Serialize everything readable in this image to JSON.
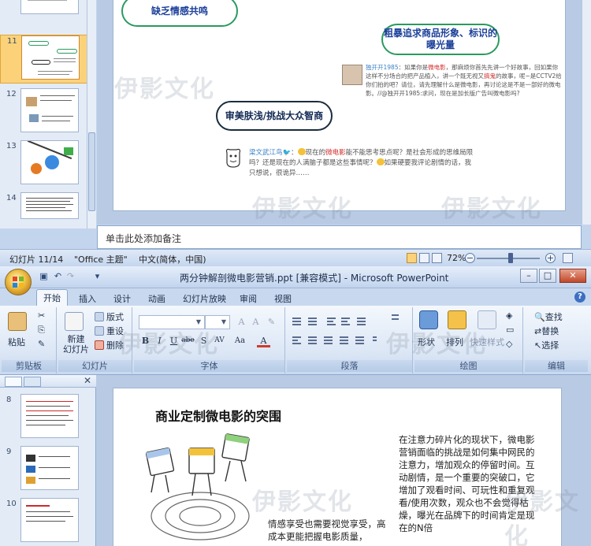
{
  "watermark": "伊影文化",
  "window1": {
    "thumbnails": [
      {
        "number": "11",
        "selected": true
      },
      {
        "number": "12",
        "selected": false
      },
      {
        "number": "13",
        "selected": false
      },
      {
        "number": "14",
        "selected": false
      }
    ],
    "slide": {
      "pill_top": "缺乏情感共鸣",
      "pill_right": "粗暴追求商品形象、标识的曝光量",
      "pill_mid": "审美肤浅/挑战大众智商",
      "weibo1": {
        "name": "独开开1985",
        "segments": [
          "：如果你是",
          "微电影",
          "，那麻烦你首先先讲一个好故事，回如果你这样不分场合的把产品植入，讲一个既无视又",
          "搞鬼",
          "的故事，呢~是CCTV2给你们拍的吧？请位，请先理解什么是微电影，再讨论这是不是一部好的微电影。//@独开开1985:求问，现在是加长版广告叫微电影吗?"
        ]
      },
      "weibo2": {
        "name": "梁文武江鸟🐦",
        "segments": [
          "：",
          "现在的",
          "微电影",
          "能不能思考思点呢？是社会形成的思维局限吗？还是现在的人满脑子都是这些事情呢？",
          "如果硬要我评论剧情的话，我只想说，很诡异……"
        ]
      }
    },
    "notes_placeholder": "单击此处添加备注",
    "status": {
      "slide_info": "幻灯片 11/14",
      "theme": "\"Office 主题\"",
      "language": "中文(简体，中国)",
      "zoom": "72%"
    }
  },
  "window2": {
    "title": "两分钟解剖微电影营销.ppt [兼容模式] - Microsoft PowerPoint",
    "tabs": [
      "开始",
      "插入",
      "设计",
      "动画",
      "幻灯片放映",
      "审阅",
      "视图"
    ],
    "active_tab": "开始",
    "ribbon": {
      "clipboard": {
        "paste": "粘贴",
        "label": "剪贴板"
      },
      "slides": {
        "new_slide": "新建\n幻灯片",
        "layout": "版式",
        "reset": "重设",
        "delete": "删除",
        "label": "幻灯片"
      },
      "font": {
        "label": "字体",
        "buttons": [
          "B",
          "I",
          "U",
          "abe",
          "S",
          "AV",
          "Aa",
          "A"
        ]
      },
      "paragraph": {
        "label": "段落"
      },
      "drawing": {
        "shape": "形状",
        "arrange": "排列",
        "quick_styles": "快速样式",
        "label": "绘图"
      },
      "editing": {
        "find": "查找",
        "replace": "替换",
        "select": "选择",
        "label": "编辑"
      }
    },
    "thumbnails": [
      {
        "number": "8"
      },
      {
        "number": "9"
      },
      {
        "number": "10"
      }
    ],
    "slide": {
      "title": "商业定制微电影的突围",
      "right_text": "在注意力碎片化的现状下，微电影营销面临的挑战是如何集中网民的注意力，增加观众的停留时间。互动剧情，是一个重要的突破口，它增加了观看时间、可玩性和重复观看/使用次数，观众也不会觉得枯燥，曝光在品牌下的时间肯定是现在的N倍",
      "left_text": "情感享受也需要视觉享受，高成本更能把握电影质量，"
    }
  }
}
